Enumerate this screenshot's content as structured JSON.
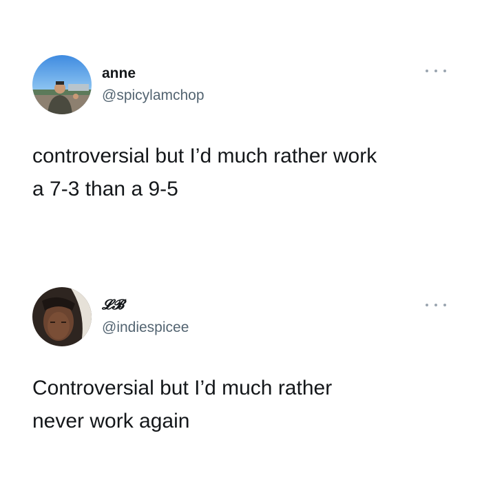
{
  "tweets": [
    {
      "display_name": "anne",
      "handle": "@spicylamchop",
      "text": "controversial but I’d much rather work\na 7-3 than a 9-5",
      "more_icon": "more-options-icon"
    },
    {
      "display_name": "𝓛𝓑",
      "handle": "@indiespicee",
      "text": "Controversial but I’d much rather\nnever work again",
      "more_icon": "more-options-icon"
    }
  ]
}
